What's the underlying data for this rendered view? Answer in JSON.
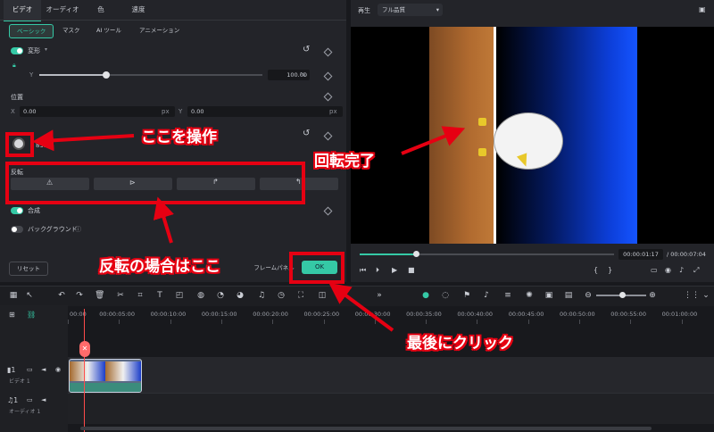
{
  "left_panel": {
    "tabs": [
      "ビデオ",
      "オーディオ",
      "色",
      "速度"
    ],
    "subtabs": [
      "ベーシック",
      "マスク",
      "AI ツール",
      "アニメーション"
    ],
    "transform_label": "変形",
    "y_label": "Y",
    "scale_value": "100.00",
    "scale_unit": "%",
    "scale_level": 0.3,
    "position_label": "位置",
    "x_label": "X",
    "x_value": "0.00",
    "pos_y_label": "Y",
    "y_value": "0.00",
    "px": "px",
    "rotate_value": "89.96",
    "flip_label": "反転",
    "composite_label": "合成",
    "background_label": "バックグラウンド",
    "reset_label": "リセット",
    "keyframe_label": "フレームパネル",
    "ok_label": "OK"
  },
  "preview": {
    "play_label": "再生",
    "quality": "フル品質",
    "current_time": "00:00:01:17",
    "total_time": "/ 00:00:07:04",
    "progress": 0.22
  },
  "timeline": {
    "ruler": [
      "00:00",
      "00:00:05:00",
      "00:00:10:00",
      "00:00:15:00",
      "00:00:20:00",
      "00:00:25:00",
      "00:00:30:00",
      "00:00:35:00",
      "00:00:40:00",
      "00:00:45:00",
      "00:00:50:00",
      "00:00:55:00",
      "00:01:00:00"
    ],
    "video_track": "ビデオ 1",
    "audio_track": "オーディオ 1",
    "video_num": "1",
    "audio_num": "1"
  },
  "annotations": {
    "operate_here": "ここを操作",
    "rotation_done": "回転完了",
    "flip_here": "反転の場合はここ",
    "click_last": "最後にクリック"
  },
  "colors": {
    "accent": "#35c9a6",
    "annotation_red": "#e60012"
  }
}
